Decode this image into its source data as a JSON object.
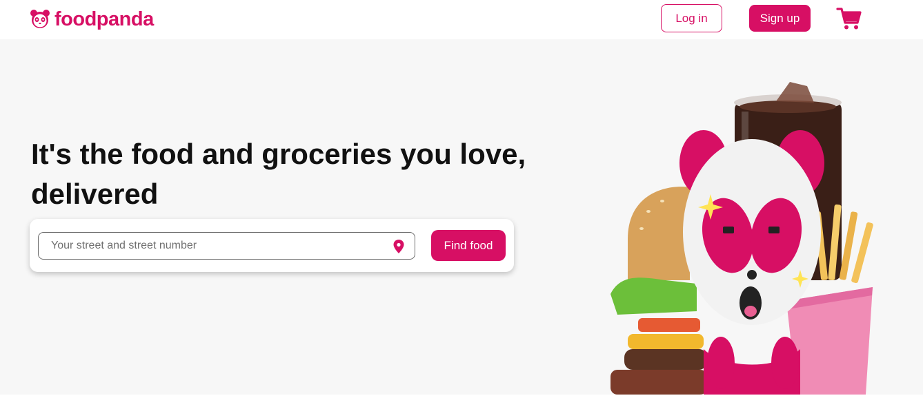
{
  "brand": {
    "name": "foodpanda",
    "color": "#d70f64",
    "logo_icon": "panda-icon"
  },
  "header": {
    "login_label": "Log in",
    "signup_label": "Sign up",
    "cart_icon": "cart-icon"
  },
  "hero": {
    "headline": "It's the food and groceries you love, delivered",
    "search": {
      "placeholder": "Your street and street number",
      "value": "",
      "locate_icon": "location-pin-icon"
    },
    "find_label": "Find food",
    "image": "panda-mascot-with-burger-fries-and-soda"
  },
  "colors": {
    "accent": "#d70f64",
    "hero_bg": "#f7f7f7",
    "text": "#111111"
  }
}
